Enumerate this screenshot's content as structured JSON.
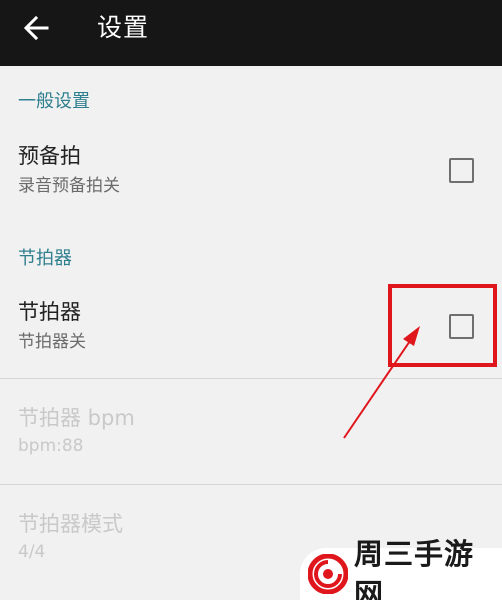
{
  "toolbar": {
    "back_icon": "arrow-back-icon",
    "title": "设置"
  },
  "sections": {
    "general": {
      "header": "一般设置",
      "count_in": {
        "title": "预备拍",
        "summary": "录音预备拍关",
        "checked": false
      }
    },
    "metronome": {
      "header": "节拍器",
      "metronome_toggle": {
        "title": "节拍器",
        "summary": "节拍器关",
        "checked": false
      },
      "bpm": {
        "title": "节拍器 bpm",
        "summary": "bpm:88",
        "enabled": false
      },
      "mode": {
        "title": "节拍器模式",
        "summary": "4/4",
        "enabled": false
      }
    }
  },
  "annotation": {
    "color": "#e0161d"
  },
  "watermark": {
    "logo_icon": "swirl-logo-icon",
    "text": "周三手游网"
  },
  "colors": {
    "toolbar_bg": "#161616",
    "section_header": "#2f7f8f",
    "background": "#f1f1f1"
  }
}
